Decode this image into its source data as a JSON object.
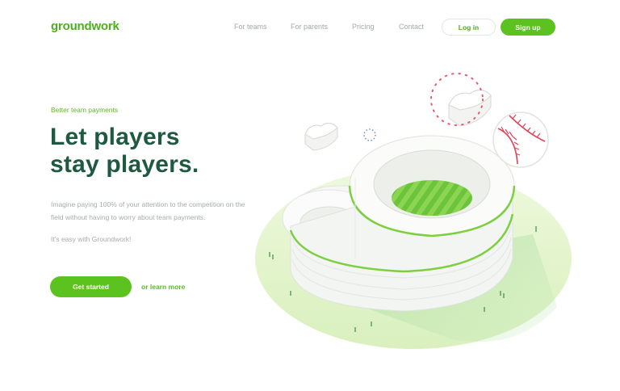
{
  "brand": {
    "logo": "groundwork",
    "accent": "#5cc21f"
  },
  "nav": {
    "links": [
      "For teams",
      "For parents",
      "Pricing",
      "Contact"
    ],
    "login_label": "Log in",
    "signup_label": "Sign up"
  },
  "hero": {
    "eyebrow": "Better team payments",
    "headline_line1": "Let players",
    "headline_line2": "stay players.",
    "body": "Imagine paying 100% of your attention to the competition on the field without having to worry about team payments.",
    "body2": "It's easy with Groundwork!",
    "cta_label": "Get started",
    "secondary_label": "or learn more"
  },
  "illustration": {
    "subject": "isometric stadium shaped like the letter g",
    "icons": [
      "baseball-icon",
      "cloud-icon",
      "dotted-circle-icon"
    ]
  }
}
